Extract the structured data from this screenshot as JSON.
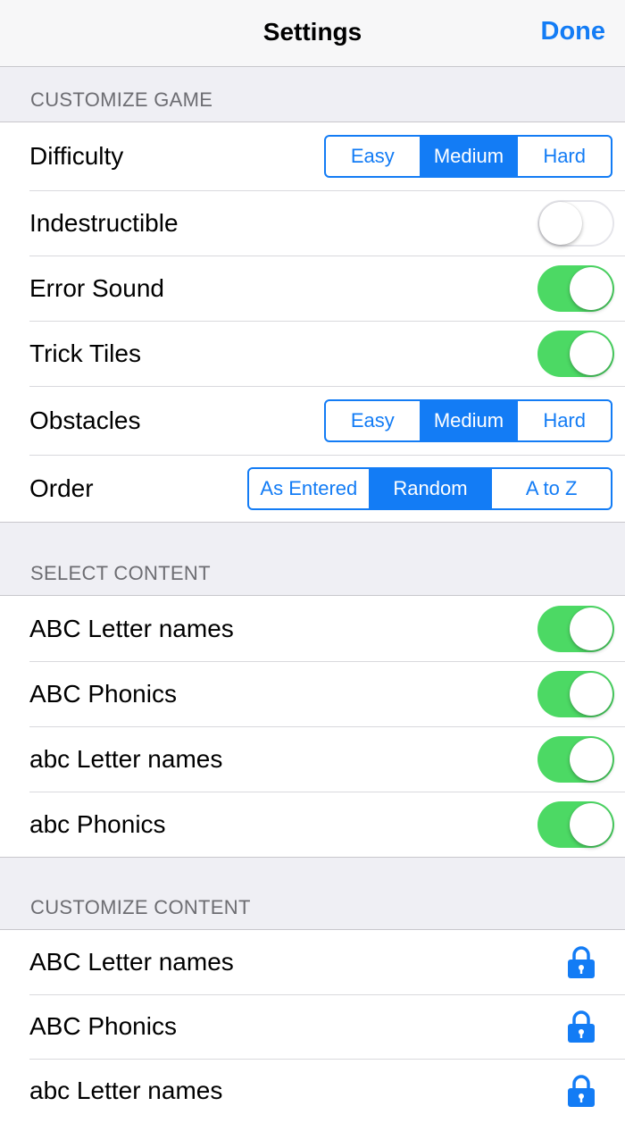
{
  "nav": {
    "title": "Settings",
    "done_label": "Done"
  },
  "colors": {
    "accent": "#137cf5",
    "toggle_on": "#4cd964",
    "background": "#efeff4"
  },
  "customize_game": {
    "header": "CUSTOMIZE GAME",
    "difficulty": {
      "label": "Difficulty",
      "options": [
        "Easy",
        "Medium",
        "Hard"
      ],
      "selected": "Medium"
    },
    "indestructible": {
      "label": "Indestructible",
      "on": false
    },
    "error_sound": {
      "label": "Error Sound",
      "on": true
    },
    "trick_tiles": {
      "label": "Trick Tiles",
      "on": true
    },
    "obstacles": {
      "label": "Obstacles",
      "options": [
        "Easy",
        "Medium",
        "Hard"
      ],
      "selected": "Medium"
    },
    "order": {
      "label": "Order",
      "options": [
        "As Entered",
        "Random",
        "A to Z"
      ],
      "selected": "Random"
    }
  },
  "select_content": {
    "header": "SELECT CONTENT",
    "items": [
      {
        "label": "ABC Letter names",
        "on": true
      },
      {
        "label": "ABC Phonics",
        "on": true
      },
      {
        "label": "abc Letter names",
        "on": true
      },
      {
        "label": "abc Phonics",
        "on": true
      }
    ]
  },
  "customize_content": {
    "header": "CUSTOMIZE CONTENT",
    "items": [
      {
        "label": "ABC Letter names",
        "icon": "lock-icon"
      },
      {
        "label": "ABC Phonics",
        "icon": "lock-icon"
      },
      {
        "label": "abc Letter names",
        "icon": "lock-icon"
      }
    ]
  }
}
